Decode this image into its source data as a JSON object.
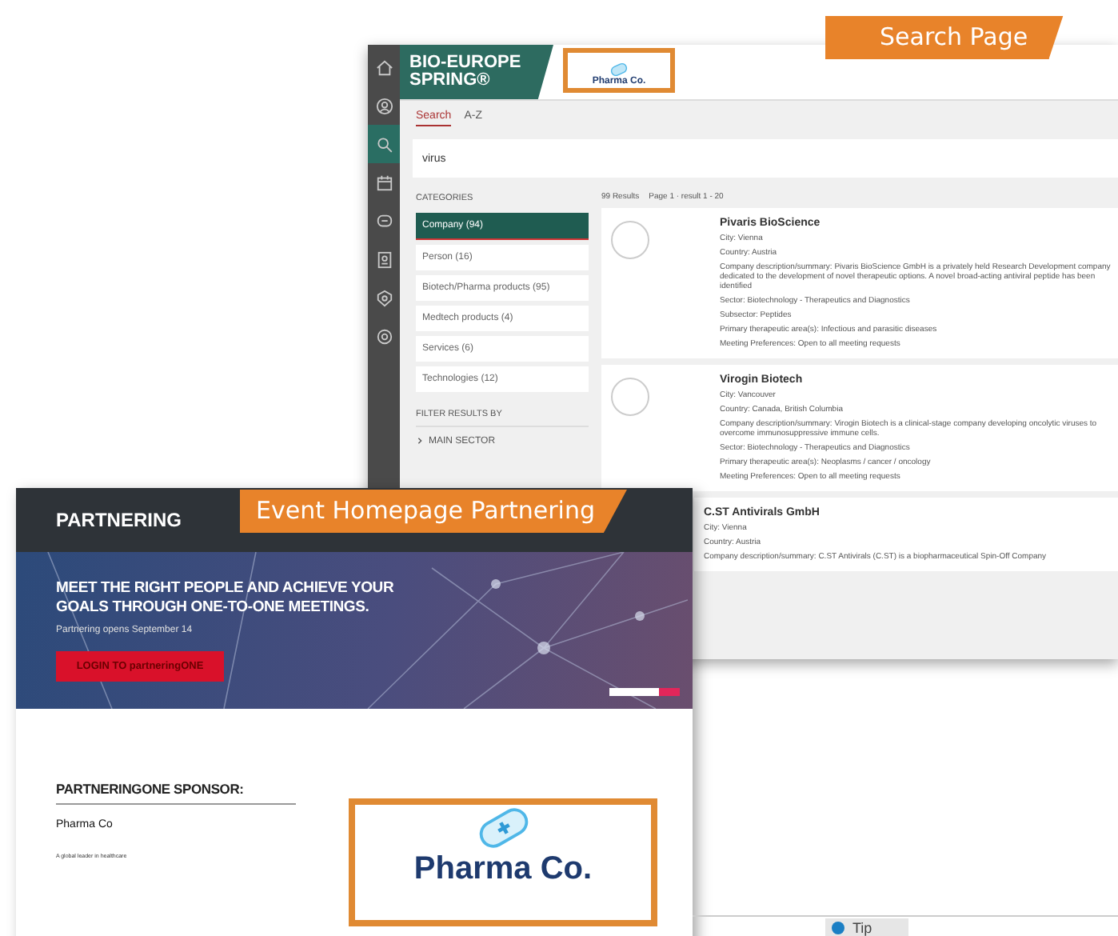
{
  "search_page": {
    "tag": "Search Page",
    "rail": [
      {
        "kind": "home",
        "selected": false
      },
      {
        "kind": "person",
        "selected": false
      },
      {
        "kind": "search",
        "selected": true
      },
      {
        "kind": "calendar",
        "selected": false
      },
      {
        "kind": "chat",
        "selected": false
      },
      {
        "kind": "contacts",
        "selected": false
      },
      {
        "kind": "badge",
        "selected": false
      },
      {
        "kind": "settings",
        "selected": false
      }
    ],
    "event_logo": {
      "line_1": "BIO-EUROPE",
      "line_2": "SPRING®"
    },
    "sponsor_logo": {
      "name": "Pharma Co."
    },
    "tabs": [
      {
        "label": "Search",
        "selected": true
      },
      {
        "label": "A-Z",
        "selected": false
      }
    ],
    "search": {
      "value": "virus"
    },
    "categories_label": "CATEGORIES",
    "categories": [
      {
        "label": "Company (94)",
        "selected": true
      },
      {
        "label": "Person (16)",
        "selected": false
      },
      {
        "label": "Biotech/Pharma products (95)",
        "selected": false
      },
      {
        "label": "Medtech products (4)",
        "selected": false
      },
      {
        "label": "Services (6)",
        "selected": false
      },
      {
        "label": "Technologies (12)",
        "selected": false
      }
    ],
    "filter_label": "FILTER RESULTS BY",
    "filters": [
      {
        "label": "MAIN SECTOR",
        "expanded": false
      }
    ],
    "results_summary": "99 Results",
    "results_page": "Page 1 · result 1 - 20",
    "results": [
      {
        "name": "Pivaris BioScience",
        "lines": [
          "City: Vienna",
          "Country: Austria",
          "Company description/summary: Pivaris BioScience GmbH is a privately held Research Development company dedicated to the development of novel therapeutic options. A novel broad-acting antiviral peptide has been identified",
          "Sector: Biotechnology - Therapeutics and Diagnostics",
          "Subsector: Peptides",
          "Primary therapeutic area(s): Infectious and parasitic diseases",
          "Meeting Preferences: Open to all meeting requests"
        ]
      },
      {
        "name": "Virogin Biotech",
        "lines": [
          "City: Vancouver",
          "Country: Canada, British Columbia",
          "Company description/summary: Virogin Biotech is a clinical-stage company developing oncolytic viruses to overcome immunosuppressive immune cells.",
          "Sector: Biotechnology - Therapeutics and Diagnostics",
          "Primary therapeutic area(s): Neoplasms / cancer / oncology",
          "Meeting Preferences: Open to all meeting requests"
        ]
      },
      {
        "name": "C.ST Antivirals GmbH",
        "lines": [
          "City: Vienna",
          "Country: Austria",
          "Company description/summary: C.ST Antivirals (C.ST) is a biopharmaceutical Spin-Off Company"
        ]
      }
    ]
  },
  "homepage": {
    "tag": "Event Homepage Partnering",
    "header": "PARTNERING",
    "headline": "MEET THE RIGHT PEOPLE AND ACHIEVE YOUR GOALS THROUGH ONE-TO-ONE MEETINGS.",
    "subline": "Partnering opens September 14",
    "login_button": "LOGIN TO partneringONE",
    "sponsor_heading": "PARTNERINGONE SPONSOR:",
    "sponsor_name": "Pharma Co",
    "sponsor_tagline": "A global leader in healthcare",
    "sponsor_logo": {
      "name": "Pharma Co."
    }
  },
  "tip_button": "Tip"
}
